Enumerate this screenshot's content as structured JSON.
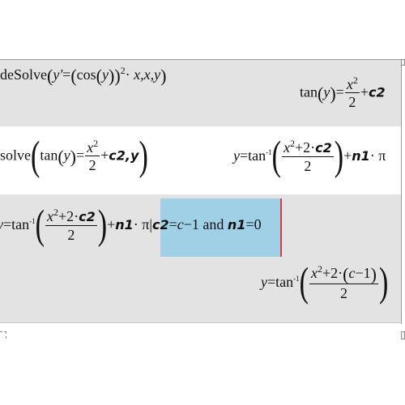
{
  "rows": [
    {
      "input": {
        "func": "deSolve",
        "arg_lhs": "y'",
        "eq": "=",
        "cos": "cos",
        "var_y": "y",
        "exp": "2",
        "dot": "·",
        "args": "x,x,y"
      },
      "output": {
        "func": "tan",
        "var_y": "y",
        "eq": "=",
        "frac_num_base": "x",
        "frac_num_exp": "2",
        "frac_den": "2",
        "plus": "+",
        "constant": "c2"
      }
    },
    {
      "input": {
        "func": "solve",
        "tan": "tan",
        "var_y": "y",
        "eq": "=",
        "frac_num_base": "x",
        "frac_num_exp": "2",
        "frac_den": "2",
        "plus": "+",
        "constant": "c2",
        "sep": ",",
        "solve_var": "y"
      },
      "output": {
        "lhs": "y",
        "eq": "=",
        "arctan": "tan",
        "inv": "-1",
        "frac_num_base": "x",
        "frac_num_exp": "2",
        "frac_num_rest": "+2·",
        "frac_num_const": "c2",
        "frac_den": "2",
        "plus": "+",
        "n_const": "n1",
        "dot": "·",
        "pi": "π"
      }
    },
    {
      "input": {
        "lhs": "y",
        "eq": "=",
        "arctan": "tan",
        "inv": "-1",
        "frac_num_base": "x",
        "frac_num_exp": "2",
        "frac_num_rest": "+2·",
        "frac_num_const": "c2",
        "frac_den": "2",
        "plus": "+",
        "n_const": "n1",
        "dot": "·",
        "pi": "π",
        "with_bar": "|",
        "cond1_const": "c2",
        "cond1_eq": "=",
        "cond1_rhs_var": "c",
        "cond1_rhs_rest": "−1",
        "and": " and ",
        "cond2_const": "n1",
        "cond2_eq": "=",
        "cond2_rhs": "0"
      },
      "output": {
        "lhs": "y",
        "eq": "=",
        "arctan": "tan",
        "inv": "-1",
        "frac_num_base": "x",
        "frac_num_exp": "2",
        "frac_num_rest": "+2·",
        "paren_var": "c",
        "paren_rest": "−1",
        "frac_den": "2"
      }
    }
  ],
  "colors": {
    "gray_band": "#e3e3e3",
    "selection": "#9fd0e6",
    "cursor": "#d44040"
  }
}
